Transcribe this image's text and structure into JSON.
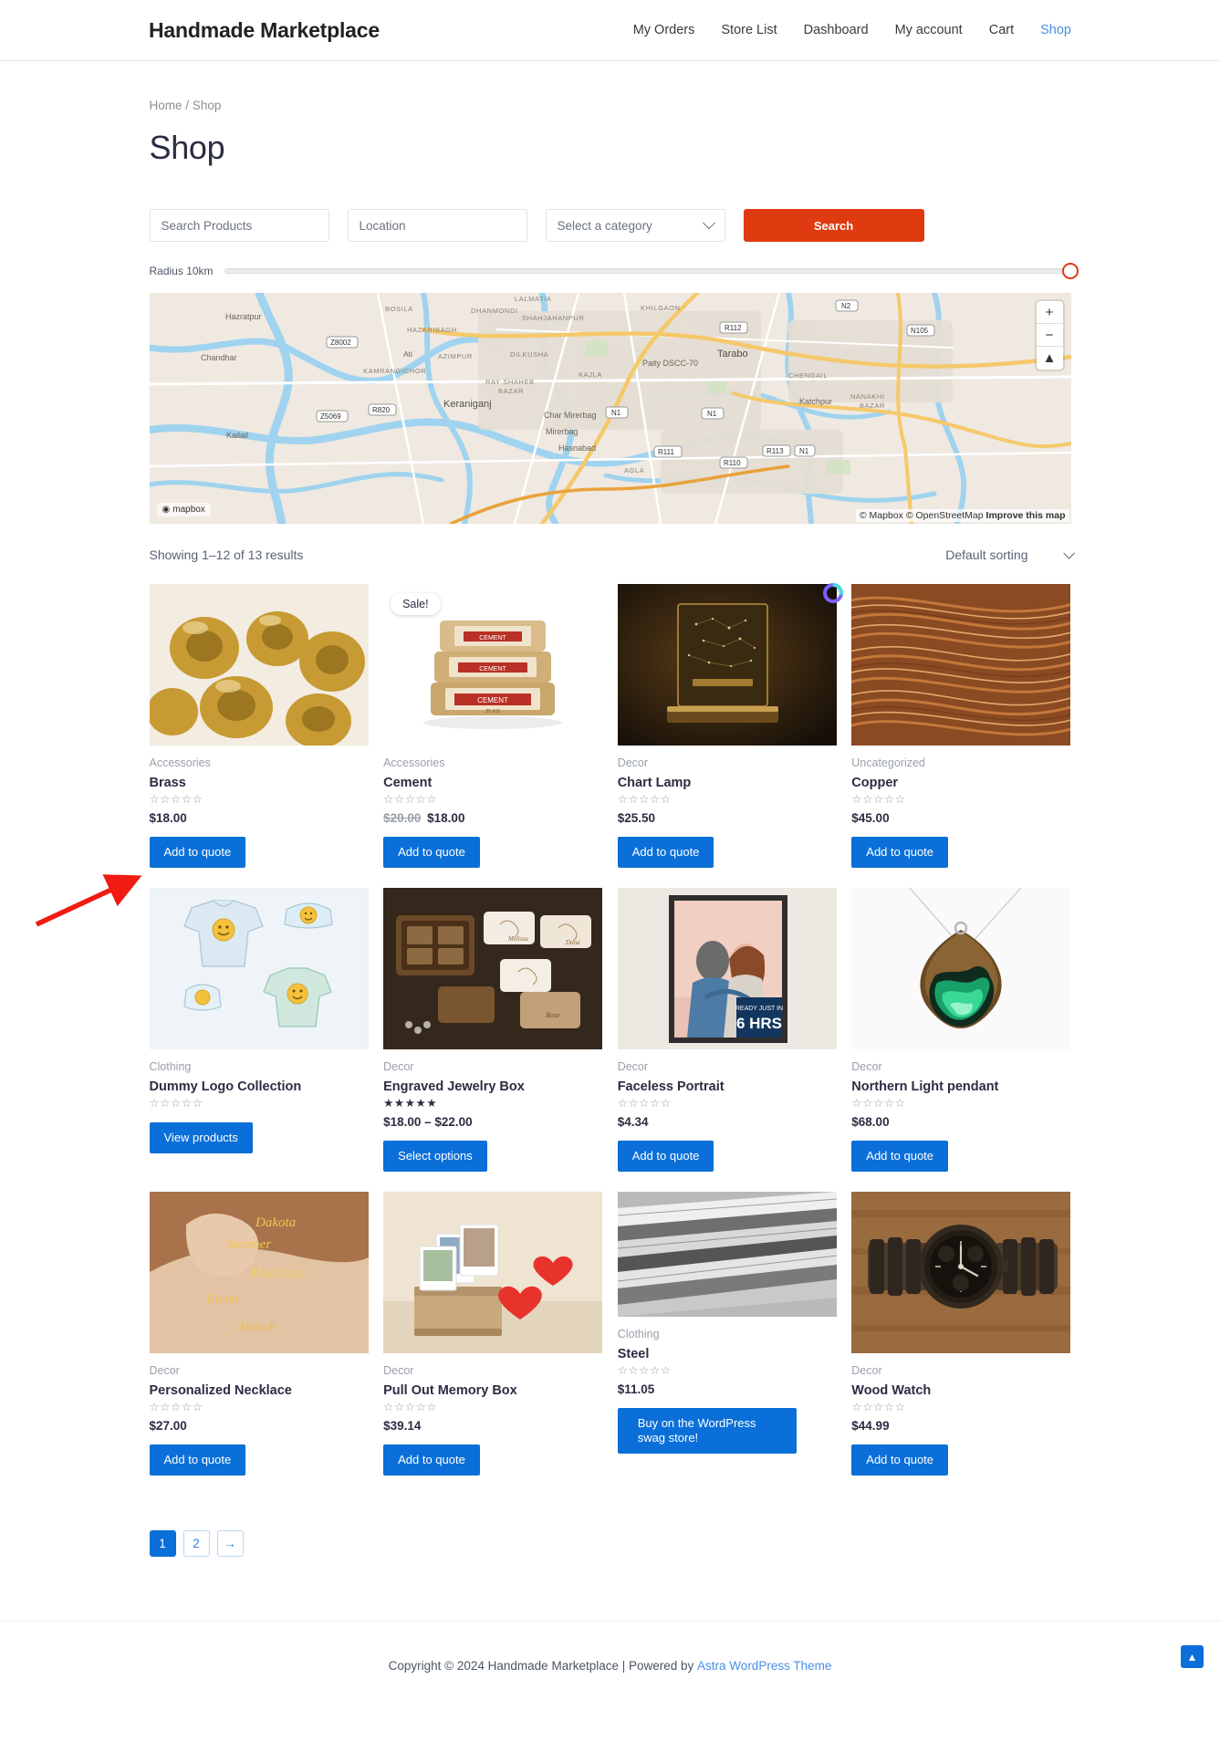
{
  "header": {
    "site_title": "Handmade Marketplace",
    "nav": [
      {
        "label": "My Orders",
        "active": false
      },
      {
        "label": "Store List",
        "active": false
      },
      {
        "label": "Dashboard",
        "active": false
      },
      {
        "label": "My account",
        "active": false
      },
      {
        "label": "Cart",
        "active": false
      },
      {
        "label": "Shop",
        "active": true
      }
    ]
  },
  "breadcrumb": {
    "home": "Home",
    "sep": "/",
    "current": "Shop"
  },
  "page_title": "Shop",
  "search": {
    "product_placeholder": "Search Products",
    "location_placeholder": "Location",
    "category_selected": "Select a category",
    "button_label": "Search",
    "radius_label": "Radius 10km"
  },
  "map": {
    "zoom_in": "+",
    "zoom_out": "−",
    "compass": "▲",
    "attribution": "© Mapbox © OpenStreetMap",
    "improve_link": "Improve this map",
    "logo": "mapbox",
    "labels": [
      "Hazratpur",
      "Chandhar",
      "Kailail",
      "Ati",
      "Keraniganj",
      "BOSILA",
      "DHANMONDI",
      "HAZARIBAGH",
      "SHAHJAHANPUR",
      "KHILGAON",
      "AZIMPUR",
      "DILKUSHA",
      "KAMRANGICHOR",
      "RAY SHAHEB BAZAR",
      "KAJLA",
      "Char Mirerbag",
      "Mirerbag",
      "Hasnabad",
      "Paity DSCC-70",
      "Tarabo",
      "CHENGAIL",
      "Katchpur",
      "NANAKHI BAZAR",
      "LALMATIA",
      "AGLA"
    ],
    "road_shields": [
      "N2",
      "R112",
      "N105",
      "Z8002",
      "Z5069",
      "R820",
      "N1",
      "R111",
      "R110",
      "R113",
      "N1"
    ]
  },
  "results": {
    "showing": "Showing 1–12 of 13 results",
    "sorting_selected": "Default sorting"
  },
  "products": [
    {
      "category": "Accessories",
      "name": "Brass",
      "rating": 0,
      "price": "$18.00",
      "old_price": null,
      "button": "Add to quote",
      "sale": false,
      "image": "brass-fittings",
      "button_wide": false
    },
    {
      "category": "Accessories",
      "name": "Cement",
      "rating": 0,
      "price": "$18.00",
      "old_price": "$20.00",
      "button": "Add to quote",
      "sale": true,
      "image": "cement-bags",
      "button_wide": false
    },
    {
      "category": "Decor",
      "name": "Chart Lamp",
      "rating": 0,
      "price": "$25.50",
      "old_price": null,
      "button": "Add to quote",
      "sale": false,
      "image": "chart-lamp",
      "button_wide": false
    },
    {
      "category": "Uncategorized",
      "name": "Copper",
      "rating": 0,
      "price": "$45.00",
      "old_price": null,
      "button": "Add to quote",
      "sale": false,
      "image": "copper-wire",
      "button_wide": false
    },
    {
      "category": "Clothing",
      "name": "Dummy Logo Collection",
      "rating": 0,
      "price": null,
      "old_price": null,
      "button": "View products",
      "sale": false,
      "image": "logo-apparel",
      "button_wide": false
    },
    {
      "category": "Decor",
      "name": "Engraved Jewelry Box",
      "rating": 5,
      "price": "$18.00 – $22.00",
      "old_price": null,
      "button": "Select options",
      "sale": false,
      "image": "jewelry-boxes",
      "button_wide": false
    },
    {
      "category": "Decor",
      "name": "Faceless Portrait",
      "rating": 0,
      "price": "$4.34",
      "old_price": null,
      "button": "Add to quote",
      "sale": false,
      "image": "faceless-portrait",
      "button_wide": false
    },
    {
      "category": "Decor",
      "name": "Northern Light pendant",
      "rating": 0,
      "price": "$68.00",
      "old_price": null,
      "button": "Add to quote",
      "sale": false,
      "image": "resin-pendant",
      "button_wide": false
    },
    {
      "category": "Decor",
      "name": "Personalized Necklace",
      "rating": 0,
      "price": "$27.00",
      "old_price": null,
      "button": "Add to quote",
      "sale": false,
      "image": "name-necklace",
      "button_wide": false
    },
    {
      "category": "Decor",
      "name": "Pull Out Memory Box",
      "rating": 0,
      "price": "$39.14",
      "old_price": null,
      "button": "Add to quote",
      "sale": false,
      "image": "memory-box",
      "button_wide": false
    },
    {
      "category": "Clothing",
      "name": "Steel",
      "rating": 0,
      "price": "$11.05",
      "old_price": null,
      "button": "Buy on the WordPress swag store!",
      "sale": false,
      "image": "steel-sheets",
      "button_wide": true
    },
    {
      "category": "Decor",
      "name": "Wood Watch",
      "rating": 0,
      "price": "$44.99",
      "old_price": null,
      "button": "Add to quote",
      "sale": false,
      "image": "wood-watch",
      "button_wide": false
    }
  ],
  "pagination": {
    "pages": [
      "1",
      "2"
    ],
    "current": "1",
    "next_glyph": "→"
  },
  "footer": {
    "copyright": "Copyright © 2024 Handmade Marketplace | Powered by",
    "theme_link": "Astra WordPress Theme",
    "scroll_top_glyph": "▲"
  },
  "colors": {
    "accent_blue": "#0a6fd8",
    "search_orange": "#e03a10",
    "link_blue": "#4a90e2",
    "text_dark": "#2b2d42",
    "muted": "#9aa0a9",
    "annotation_red": "#f01b12"
  }
}
